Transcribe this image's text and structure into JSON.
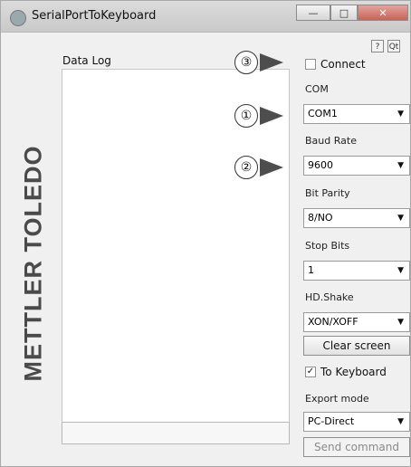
{
  "window": {
    "title": "SerialPortToKeyboard"
  },
  "brand": {
    "text": "METTLER TOLEDO"
  },
  "datalog": {
    "label": "Data Log"
  },
  "icons": {
    "help": "?",
    "qt": "Qt"
  },
  "controls": {
    "connect": {
      "label": "Connect",
      "checked": false
    },
    "com": {
      "label": "COM",
      "value": "COM1"
    },
    "baud": {
      "label": "Baud Rate",
      "value": "9600"
    },
    "parity": {
      "label": "Bit Parity",
      "value": "8/NO"
    },
    "stopbits": {
      "label": "Stop Bits",
      "value": "1"
    },
    "handshake": {
      "label": "HD.Shake",
      "value": "XON/XOFF"
    },
    "clear_screen": "Clear screen",
    "to_keyboard": {
      "label": "To Keyboard",
      "checked": true
    },
    "export_mode": {
      "label": "Export mode",
      "value": "PC-Direct"
    },
    "send_command": "Send command"
  },
  "annotations": {
    "a1": "①",
    "a2": "②",
    "a3": "③"
  }
}
